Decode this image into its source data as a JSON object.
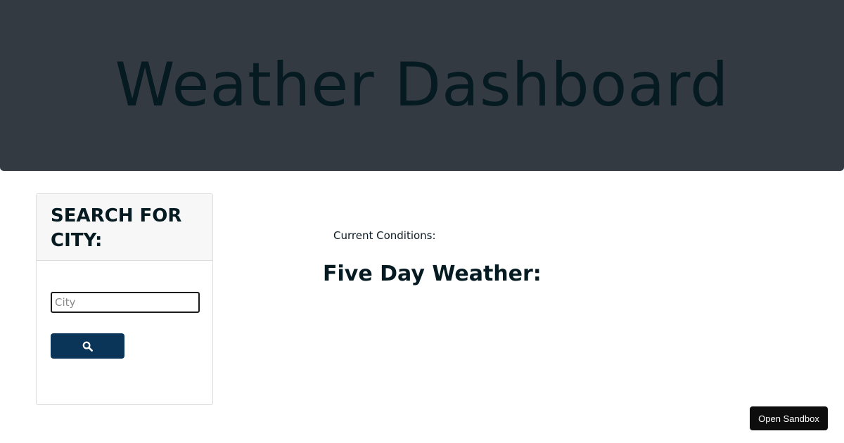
{
  "header": {
    "title": "Weather Dashboard"
  },
  "search": {
    "heading": "SEARCH FOR CITY:",
    "input_placeholder": "City",
    "input_value": "",
    "button_icon": "search-icon"
  },
  "main": {
    "current_conditions_label": "Current Conditions:",
    "five_day_title": "Five Day Weather:"
  },
  "sandbox": {
    "button_label": "Open Sandbox"
  },
  "colors": {
    "header_bg": "#343a42",
    "button_bg": "#0b3558",
    "sandbox_bg": "#0d0d0d"
  }
}
